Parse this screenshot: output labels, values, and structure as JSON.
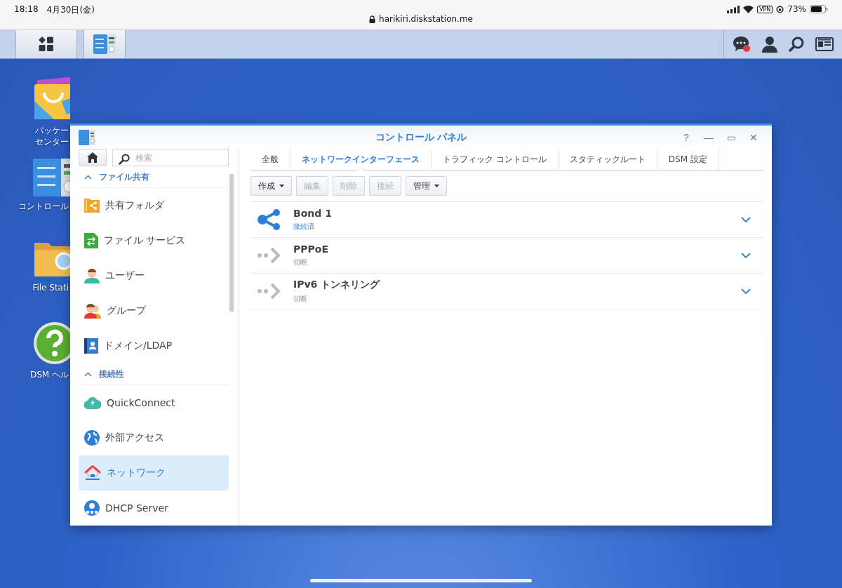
{
  "status_bar": {
    "time": "18:18",
    "date": "4月30日(金)",
    "url": "harikiri.diskstation.me",
    "vpn": "VPN",
    "battery": "73%"
  },
  "desktop_icons": [
    {
      "label_lines": [
        "パッケー",
        "センター"
      ]
    },
    {
      "label_lines": [
        "コントロール"
      ]
    },
    {
      "label_lines": [
        "File Stati"
      ]
    },
    {
      "label_lines": [
        "DSM ヘル"
      ]
    }
  ],
  "window": {
    "title": "コントロール パネル",
    "controls": [
      "?",
      "—",
      "▭",
      "✕"
    ]
  },
  "sidebar": {
    "search": {
      "placeholder": "検索"
    },
    "sections": [
      {
        "title": "ファイル共有",
        "expanded": true,
        "items": [
          {
            "label": "共有フォルダ",
            "selected": false
          },
          {
            "label": "ファイル サービス",
            "selected": false
          },
          {
            "label": "ユーザー",
            "selected": false
          },
          {
            "label": "グループ",
            "selected": false
          },
          {
            "label": "ドメイン/LDAP",
            "selected": false
          }
        ]
      },
      {
        "title": "接続性",
        "expanded": true,
        "items": [
          {
            "label": "QuickConnect",
            "selected": false
          },
          {
            "label": "外部アクセス",
            "selected": false
          },
          {
            "label": "ネットワーク",
            "selected": true
          },
          {
            "label": "DHCP Server",
            "selected": false
          }
        ]
      }
    ]
  },
  "tabs": [
    {
      "label": "全般",
      "selected": false
    },
    {
      "label": "ネットワークインターフェース",
      "selected": true
    },
    {
      "label": "トラフィック コントロール",
      "selected": false
    },
    {
      "label": "スタティックルート",
      "selected": false
    },
    {
      "label": "DSM 設定",
      "selected": false
    }
  ],
  "toolbar": [
    {
      "label": "作成",
      "dropdown": true,
      "disabled": false
    },
    {
      "label": "編集",
      "dropdown": false,
      "disabled": true
    },
    {
      "label": "削除",
      "dropdown": false,
      "disabled": true
    },
    {
      "label": "接続",
      "dropdown": false,
      "disabled": true
    },
    {
      "label": "管理",
      "dropdown": true,
      "disabled": false
    }
  ],
  "interfaces": [
    {
      "name": "Bond 1",
      "status": "接続済",
      "connected": true
    },
    {
      "name": "PPPoE",
      "status": "切断",
      "connected": false
    },
    {
      "name": "IPv6 トンネリング",
      "status": "切断",
      "connected": false
    }
  ]
}
